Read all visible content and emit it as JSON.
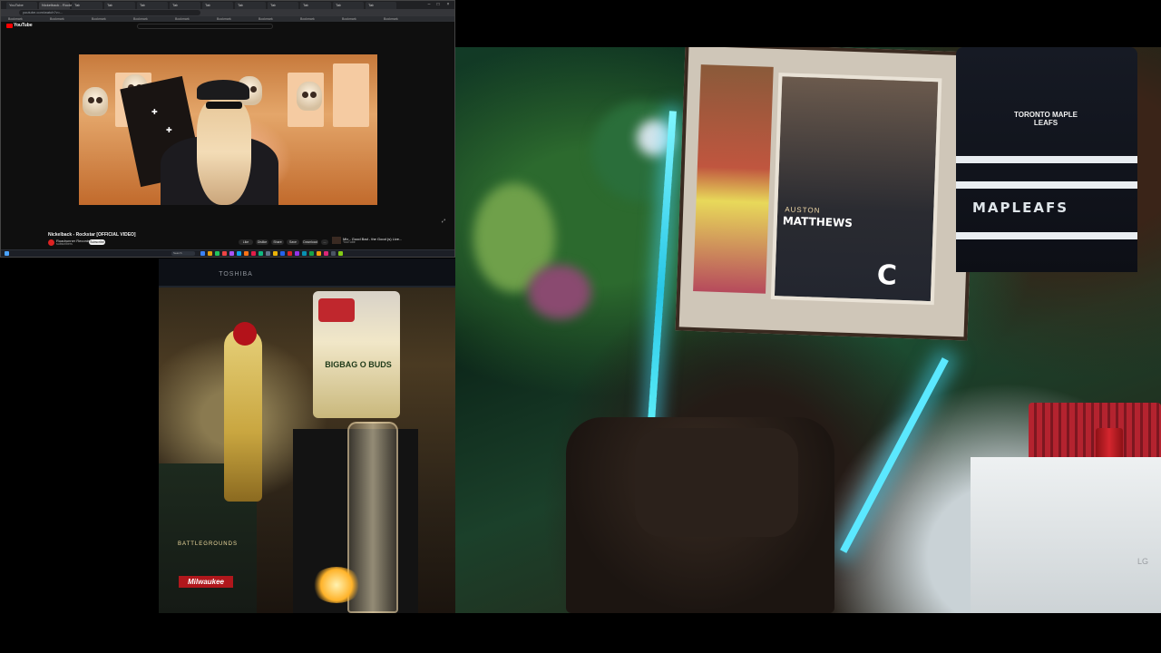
{
  "browser": {
    "tabs": [
      {
        "label": "YouTube"
      },
      {
        "label": "Nickelback - Rockstar"
      },
      {
        "label": "Tab"
      },
      {
        "label": "Tab"
      },
      {
        "label": "Tab"
      },
      {
        "label": "Tab"
      },
      {
        "label": "Tab"
      },
      {
        "label": "Tab"
      },
      {
        "label": "Tab"
      },
      {
        "label": "Tab"
      },
      {
        "label": "Tab"
      },
      {
        "label": "Tab"
      }
    ],
    "url": "youtube.com/watch?v=...",
    "bookmarks": [
      "Bookmark",
      "Bookmark",
      "Bookmark",
      "Bookmark",
      "Bookmark",
      "Bookmark",
      "Bookmark",
      "Bookmark",
      "Bookmark",
      "Bookmark"
    ],
    "window_controls": {
      "minimize": "–",
      "maximize": "□",
      "close": "×"
    }
  },
  "youtube": {
    "logo_text": "YouTube",
    "video_title": "Nickelback - Rockstar [OFFICIAL VIDEO]",
    "channel_name": "Roadrunner Records",
    "channel_subs": "subscribers",
    "subscribe_label": "Subscribe",
    "actions": [
      "Like",
      "Dislike",
      "Share",
      "Save",
      "Download",
      "..."
    ],
    "up_next_title": "Mix - Good Bad - the Good (s) Live...",
    "up_next_meta": "YouTube",
    "expand_icon": "expand-icon"
  },
  "taskbar": {
    "search_placeholder": "Search",
    "time": "",
    "icon_colors": [
      "#3b82f6",
      "#e5a00d",
      "#22c55e",
      "#ef4444",
      "#a855f7",
      "#0ea5e9",
      "#f97316",
      "#e11d48",
      "#10b981",
      "#64748b",
      "#eab308",
      "#2563eb",
      "#dc2626",
      "#9333ea",
      "#0891b2",
      "#16a34a",
      "#f59e0b",
      "#db2777",
      "#4b5563",
      "#84cc16"
    ]
  },
  "webcam": {
    "poster_line_1": "AUSTON",
    "poster_line_2": "MATTHEWS",
    "poster_letter": "C",
    "jersey_logo": "TORONTO MAPLE LEAFS",
    "jersey_text": "MAPLEAFS",
    "fridge_logo": "LG"
  },
  "desk": {
    "monitor_brand": "TOSHIBA",
    "bag_title": "BIGBAG O BUDS",
    "box_label_1": "BATTLEGROUNDS",
    "box_label_2": "Milwaukee"
  }
}
